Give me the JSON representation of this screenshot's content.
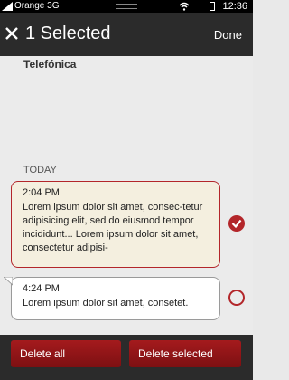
{
  "status_bar": {
    "carrier": "Orange 3G",
    "time": "12:36"
  },
  "header": {
    "title": "1 Selected",
    "done_label": "Done",
    "close_icon": "close-icon"
  },
  "conversation": {
    "sender": "Telefónica",
    "section_label": "TODAY",
    "messages": [
      {
        "time": "2:04 PM",
        "text": "Lorem ipsum dolor sit amet, consec-tetur adipisicing elit, sed do eiusmod tempor incididunt... Lorem ipsum dolor sit amet, consectetur adipisi-",
        "selected": true
      },
      {
        "time": "4:24 PM",
        "text": "Lorem ipsum dolor sit amet, consetet.",
        "selected": false
      }
    ]
  },
  "footer": {
    "delete_all_label": "Delete all",
    "delete_selected_label": "Delete selected"
  },
  "colors": {
    "accent": "#b3262a",
    "header_bg": "#2b2b2b",
    "selected_bubble": "#f4efdf"
  }
}
